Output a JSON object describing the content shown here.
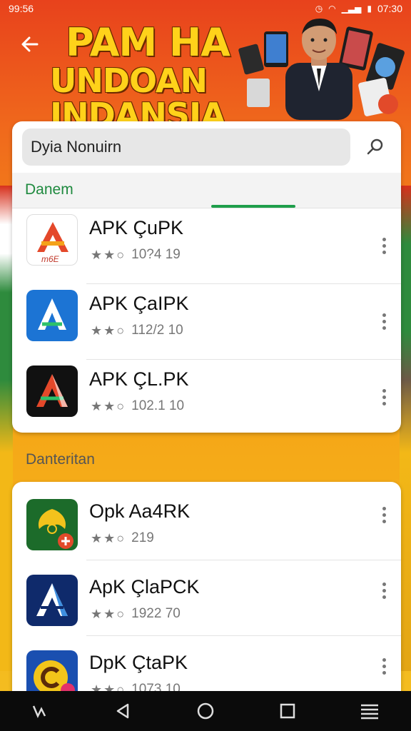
{
  "status_bar": {
    "left_time": "99:56",
    "right_time": "07:30"
  },
  "header": {
    "back_icon": "arrow-left-icon",
    "banner_line1": "PAM HA",
    "banner_line2": "UNDOAN INDANSIA"
  },
  "search": {
    "value": "Dyia Nonuirn",
    "icon": "search-icon"
  },
  "tab": {
    "label": "Danem"
  },
  "section2": {
    "label": "Danteritan"
  },
  "apps": [
    {
      "name": "APK ÇuPK",
      "rating": "★★★",
      "stars_hint": "3",
      "meta": "10?4 19",
      "icon_letter": "A",
      "icon_sub": "m6E",
      "color": "#e4482a"
    },
    {
      "name": "APK ÇaIPK",
      "rating": "★★★",
      "meta": "112/2 10",
      "icon_letter": "A",
      "color": "#1c74d4"
    },
    {
      "name": "APK ÇL.PK",
      "rating": "★★★",
      "meta": "102.1 10",
      "icon_letter": "A",
      "color": "#111111"
    }
  ],
  "apps2": [
    {
      "name": "Opk Aa4RK",
      "meta": "219",
      "icon_letter": "A",
      "color": "#1c6b2a"
    },
    {
      "name": "ApK ÇlaPCK",
      "meta": "1922 70",
      "icon_letter": "A",
      "color": "#0f2a6b"
    },
    {
      "name": "DpK ÇtaPK",
      "meta": "1073 10",
      "icon_letter": "C",
      "color": "#f2c51a"
    }
  ],
  "nav": {
    "items": [
      "recents-icon",
      "back-triangle-icon",
      "home-circle-icon",
      "overview-square-icon",
      "menu-lines-icon"
    ]
  },
  "colors": {
    "accent_green": "#1e9e4a",
    "banner_gold": "#ffd21a",
    "bg_orange": "#f06a1c"
  }
}
